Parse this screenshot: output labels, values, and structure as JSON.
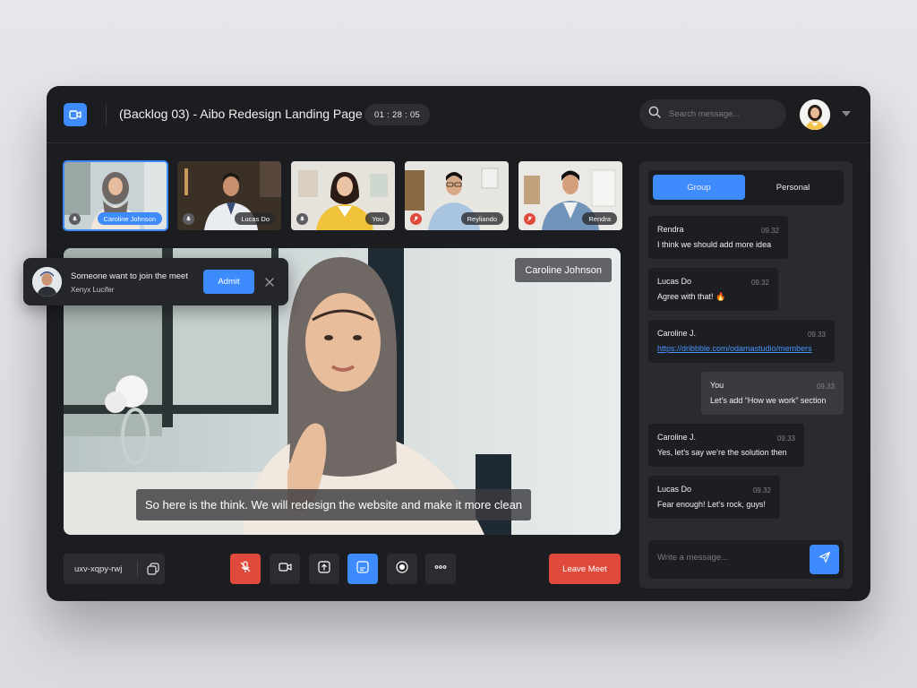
{
  "meeting": {
    "title": "(Backlog 03) - Aibo Redesign Landing Page",
    "timer": "01 : 28 : 05",
    "code": "uxv-xqpy-rwj"
  },
  "search": {
    "placeholder": "Search message..."
  },
  "participants": [
    {
      "name": "Caroline Johnson",
      "muted": false,
      "active": true
    },
    {
      "name": "Lucas Do",
      "muted": false,
      "active": false
    },
    {
      "name": "You",
      "muted": false,
      "active": false
    },
    {
      "name": "Reyliando",
      "muted": true,
      "active": false
    },
    {
      "name": "Rendra",
      "muted": true,
      "active": false
    }
  ],
  "stage": {
    "speaker": "Caroline Johnson",
    "caption": "So here is the think. We will redesign the website and make it more clean"
  },
  "toast": {
    "title": "Someone want to join the meet",
    "name": "Xenyx Lucifer",
    "admit_label": "Admit"
  },
  "controls": {
    "leave_label": "Leave Meet",
    "buttons": [
      "mic-muted",
      "camera",
      "share-screen",
      "captions",
      "record",
      "more"
    ]
  },
  "chat": {
    "tabs": [
      {
        "label": "Group",
        "active": true
      },
      {
        "label": "Personal",
        "active": false
      }
    ],
    "messages": [
      {
        "sender": "Rendra",
        "time": "09.32",
        "text": "I think we should add more idea"
      },
      {
        "sender": "Lucas Do",
        "time": "09.32",
        "text": "Agree with that! 🔥"
      },
      {
        "sender": "Caroline J.",
        "time": "09.33",
        "text": "https://dribbble.com/odamastudio/members"
      },
      {
        "sender": "You",
        "time": "09.33",
        "text": "Let’s add “How we work” section"
      },
      {
        "sender": "Caroline J.",
        "time": "09.33",
        "text": "Yes, let’s say we’re the solution then"
      },
      {
        "sender": "Lucas Do",
        "time": "09.32",
        "text": "Fear enough! Let’s rock, guys!"
      }
    ],
    "composer_placeholder": "Write a message..."
  },
  "colors": {
    "accent": "#3d8bfd",
    "danger": "#e04a3c",
    "panel": "#1c1d20",
    "surface": "#2a2b2f"
  }
}
